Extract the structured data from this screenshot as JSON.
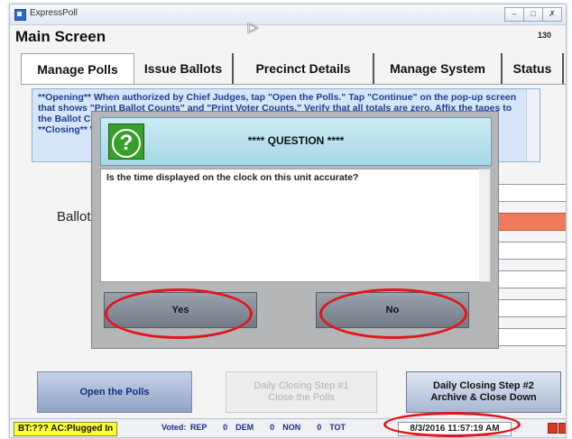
{
  "window": {
    "app_title": "ExpressPoll",
    "minimize_glyph": "–",
    "maximize_glyph": "□",
    "close_glyph": "✗"
  },
  "header": {
    "title": "Main Screen",
    "counter": "130"
  },
  "tabs": [
    "Manage Polls",
    "Issue Ballots",
    "Precinct Details",
    "Manage System",
    "Status"
  ],
  "instructions": "**Opening** When authorized by Chief Judges, tap \"Open the Polls.\" Tap \"Continue\" on the pop-up screen that shows \"Print Ballot Counts\" and \"Print Voter Counts.\" Verify that all totals are zero. Affix the tapes to the Ballot Count Report and tap \"Done.\" Begin checking-in voters.\n**Closing** When authorized by Chief Judges, follow the closing steps in order.",
  "ballot_label": "Ballot",
  "dialog": {
    "title": "**** QUESTION ****",
    "icon": "question-icon",
    "icon_glyph": "?",
    "message": "Is the time displayed on the clock on this unit accurate?",
    "yes_label": "Yes",
    "no_label": "No"
  },
  "buttons": {
    "open_polls": "Open the Polls",
    "step1": "Daily Closing Step #1\nClose the Polls",
    "step2": "Daily Closing Step #2\nArchive & Close Down"
  },
  "status_bar": {
    "battery": "BT:??? AC:Plugged In",
    "voted": "Voted: REP    0  DEM    0  NON    0  TOT",
    "clock": "8/3/2016 11:57:19 AM"
  },
  "colors": {
    "accent_red": "#e3151b",
    "info_text": "#1f3f8f",
    "battery_bg": "#ffff30",
    "question_green": "#38a02a"
  }
}
